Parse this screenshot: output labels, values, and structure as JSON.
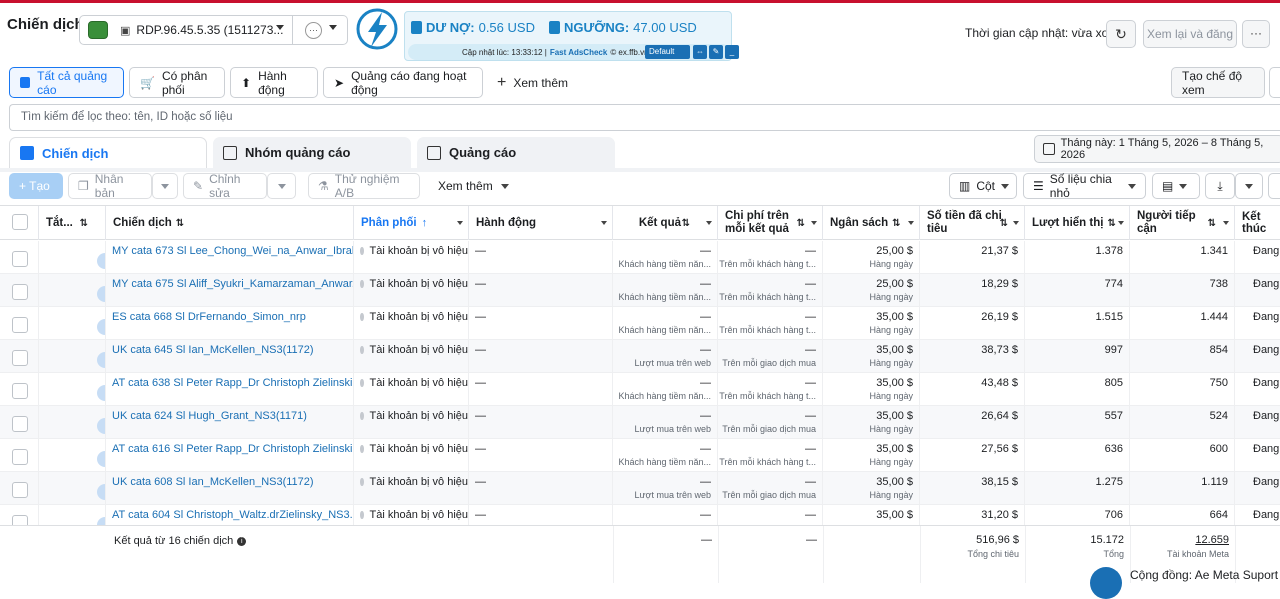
{
  "page_title": "Chiến dịch",
  "account": {
    "name": "RDP.96.45.5.35 (1511273...",
    "extra_indicator": "···"
  },
  "extension": {
    "debt_label": "DƯ NỢ:",
    "debt_value": "0.56 USD",
    "threshold_label": "NGƯỠNG:",
    "threshold_value": "47.00 USD",
    "updated_text": "Cập nhật lúc: 13:33:12 |",
    "brand": "Fast AdsCheck",
    "brand_suffix": "© ex.ffb.vn",
    "profile": "Default",
    "colors": {
      "brand": "#1a82c4",
      "panel": "#eaf5fb"
    }
  },
  "header_right": {
    "update_status": "Thời gian cập nhật: vừa xong",
    "review_button": "Xem lại và đăng",
    "more_button": "···"
  },
  "filters": {
    "all_ads": "Tất cả quảng cáo",
    "has_delivery": "Có phân phối",
    "actions": "Hành động",
    "active_ads": "Quảng cáo đang hoạt động",
    "add_more": "Xem thêm",
    "create_view": "Tạo chế độ xem"
  },
  "search": {
    "placeholder": "Tìm kiếm để lọc theo: tên, ID hoặc số liệu"
  },
  "tabs": {
    "campaigns": "Chiến dịch",
    "adsets": "Nhóm quảng cáo",
    "ads": "Quảng cáo",
    "date_range": "Tháng này: 1 Tháng 5, 2026 – 8 Tháng 5, 2026"
  },
  "toolbar": {
    "create": "+ Tạo",
    "duplicate": "Nhân bản",
    "edit": "Chỉnh sửa",
    "ab_test": "Thử nghiệm A/B",
    "more": "Xem thêm",
    "columns": "Cột",
    "breakdown": "Số liệu chia nhỏ"
  },
  "columns": {
    "toggle": "Tắt...",
    "campaign": "Chiến dịch",
    "delivery": "Phân phối",
    "actions": "Hành động",
    "results": "Kết quả",
    "cost_per_result_1": "Chi phí trên",
    "cost_per_result_2": "mỗi kết quả",
    "budget": "Ngân sách",
    "amount_spent_1": "Số tiền đã chi",
    "amount_spent_2": "tiêu",
    "impressions": "Lượt hiển thị",
    "reach_1": "Người tiếp",
    "reach_2": "cận",
    "end": "Kết thúc"
  },
  "rows": [
    {
      "name": "MY cata 673 Sl Lee_Chong_Wei_na_Anwar_Ibrahi...",
      "delivery": "Tài khoản bị vô hiệu",
      "action": "—",
      "result": "—",
      "result_sub": "Khách hàng tiềm năn...",
      "cpr": "—",
      "cpr_sub": "Trên mỗi khách hàng t...",
      "budget": "25,00 $",
      "budget_sub": "Hàng ngày",
      "spent": "21,37 $",
      "impressions": "1.378",
      "reach": "1.341",
      "end": "Đang"
    },
    {
      "name": "MY cata 675 Sl Aliff_Syukri_Kamarzaman_Anwar...",
      "delivery": "Tài khoản bị vô hiệu",
      "action": "—",
      "result": "—",
      "result_sub": "Khách hàng tiềm năn...",
      "cpr": "—",
      "cpr_sub": "Trên mỗi khách hàng t...",
      "budget": "25,00 $",
      "budget_sub": "Hàng ngày",
      "spent": "18,29 $",
      "impressions": "774",
      "reach": "738",
      "end": "Đang"
    },
    {
      "name": "ES cata 668 Sl DrFernando_Simon_nrp",
      "delivery": "Tài khoản bị vô hiệu",
      "action": "—",
      "result": "—",
      "result_sub": "Khách hàng tiềm năn...",
      "cpr": "—",
      "cpr_sub": "Trên mỗi khách hàng t...",
      "budget": "35,00 $",
      "budget_sub": "Hàng ngày",
      "spent": "26,19 $",
      "impressions": "1.515",
      "reach": "1.444",
      "end": "Đang"
    },
    {
      "name": "UK cata 645 Sl Ian_McKellen_NS3(1172)",
      "delivery": "Tài khoản bị vô hiệu",
      "action": "—",
      "result": "—",
      "result_sub": "Lượt mua trên web",
      "cpr": "—",
      "cpr_sub": "Trên mỗi giao dịch mua",
      "budget": "35,00 $",
      "budget_sub": "Hàng ngày",
      "spent": "38,73 $",
      "impressions": "997",
      "reach": "854",
      "end": "Đang"
    },
    {
      "name": "AT cata 638 Sl Peter Rapp_Dr Christoph Zielinski...",
      "delivery": "Tài khoản bị vô hiệu",
      "action": "—",
      "result": "—",
      "result_sub": "Khách hàng tiềm năn...",
      "cpr": "—",
      "cpr_sub": "Trên mỗi khách hàng t...",
      "budget": "35,00 $",
      "budget_sub": "Hàng ngày",
      "spent": "43,48 $",
      "impressions": "805",
      "reach": "750",
      "end": "Đang"
    },
    {
      "name": "UK cata 624 Sl Hugh_Grant_NS3(1171)",
      "delivery": "Tài khoản bị vô hiệu",
      "action": "—",
      "result": "—",
      "result_sub": "Lượt mua trên web",
      "cpr": "—",
      "cpr_sub": "Trên mỗi giao dịch mua",
      "budget": "35,00 $",
      "budget_sub": "Hàng ngày",
      "spent": "26,64 $",
      "impressions": "557",
      "reach": "524",
      "end": "Đang"
    },
    {
      "name": "AT cata 616 Sl Peter Rapp_Dr Christoph Zielinski...",
      "delivery": "Tài khoản bị vô hiệu",
      "action": "—",
      "result": "—",
      "result_sub": "Khách hàng tiềm năn...",
      "cpr": "—",
      "cpr_sub": "Trên mỗi khách hàng t...",
      "budget": "35,00 $",
      "budget_sub": "Hàng ngày",
      "spent": "27,56 $",
      "impressions": "636",
      "reach": "600",
      "end": "Đang"
    },
    {
      "name": "UK cata 608 Sl Ian_McKellen_NS3(1172)",
      "delivery": "Tài khoản bị vô hiệu",
      "action": "—",
      "result": "—",
      "result_sub": "Lượt mua trên web",
      "cpr": "—",
      "cpr_sub": "Trên mỗi giao dịch mua",
      "budget": "35,00 $",
      "budget_sub": "Hàng ngày",
      "spent": "38,15 $",
      "impressions": "1.275",
      "reach": "1.119",
      "end": "Đang"
    },
    {
      "name": "AT cata 604 Sl Christoph_Waltz.drZielinsky_NS3...",
      "delivery": "Tài khoản bị vô hiệu",
      "action": "—",
      "result": "—",
      "result_sub": "",
      "cpr": "—",
      "cpr_sub": "",
      "budget": "35,00 $",
      "budget_sub": "",
      "spent": "31,20 $",
      "impressions": "706",
      "reach": "664",
      "end": "Đang"
    }
  ],
  "summary": {
    "label": "Kết quả từ 16 chiến dịch",
    "result": "—",
    "cpr": "—",
    "spent": "516,96 $",
    "spent_sub": "Tổng chi tiêu",
    "impressions": "15.172",
    "impressions_sub": "Tổng",
    "reach": "12.659",
    "reach_sub": "Tài khoản Meta"
  },
  "community": {
    "label": "Cộng đồng: Ae Meta Suport"
  }
}
